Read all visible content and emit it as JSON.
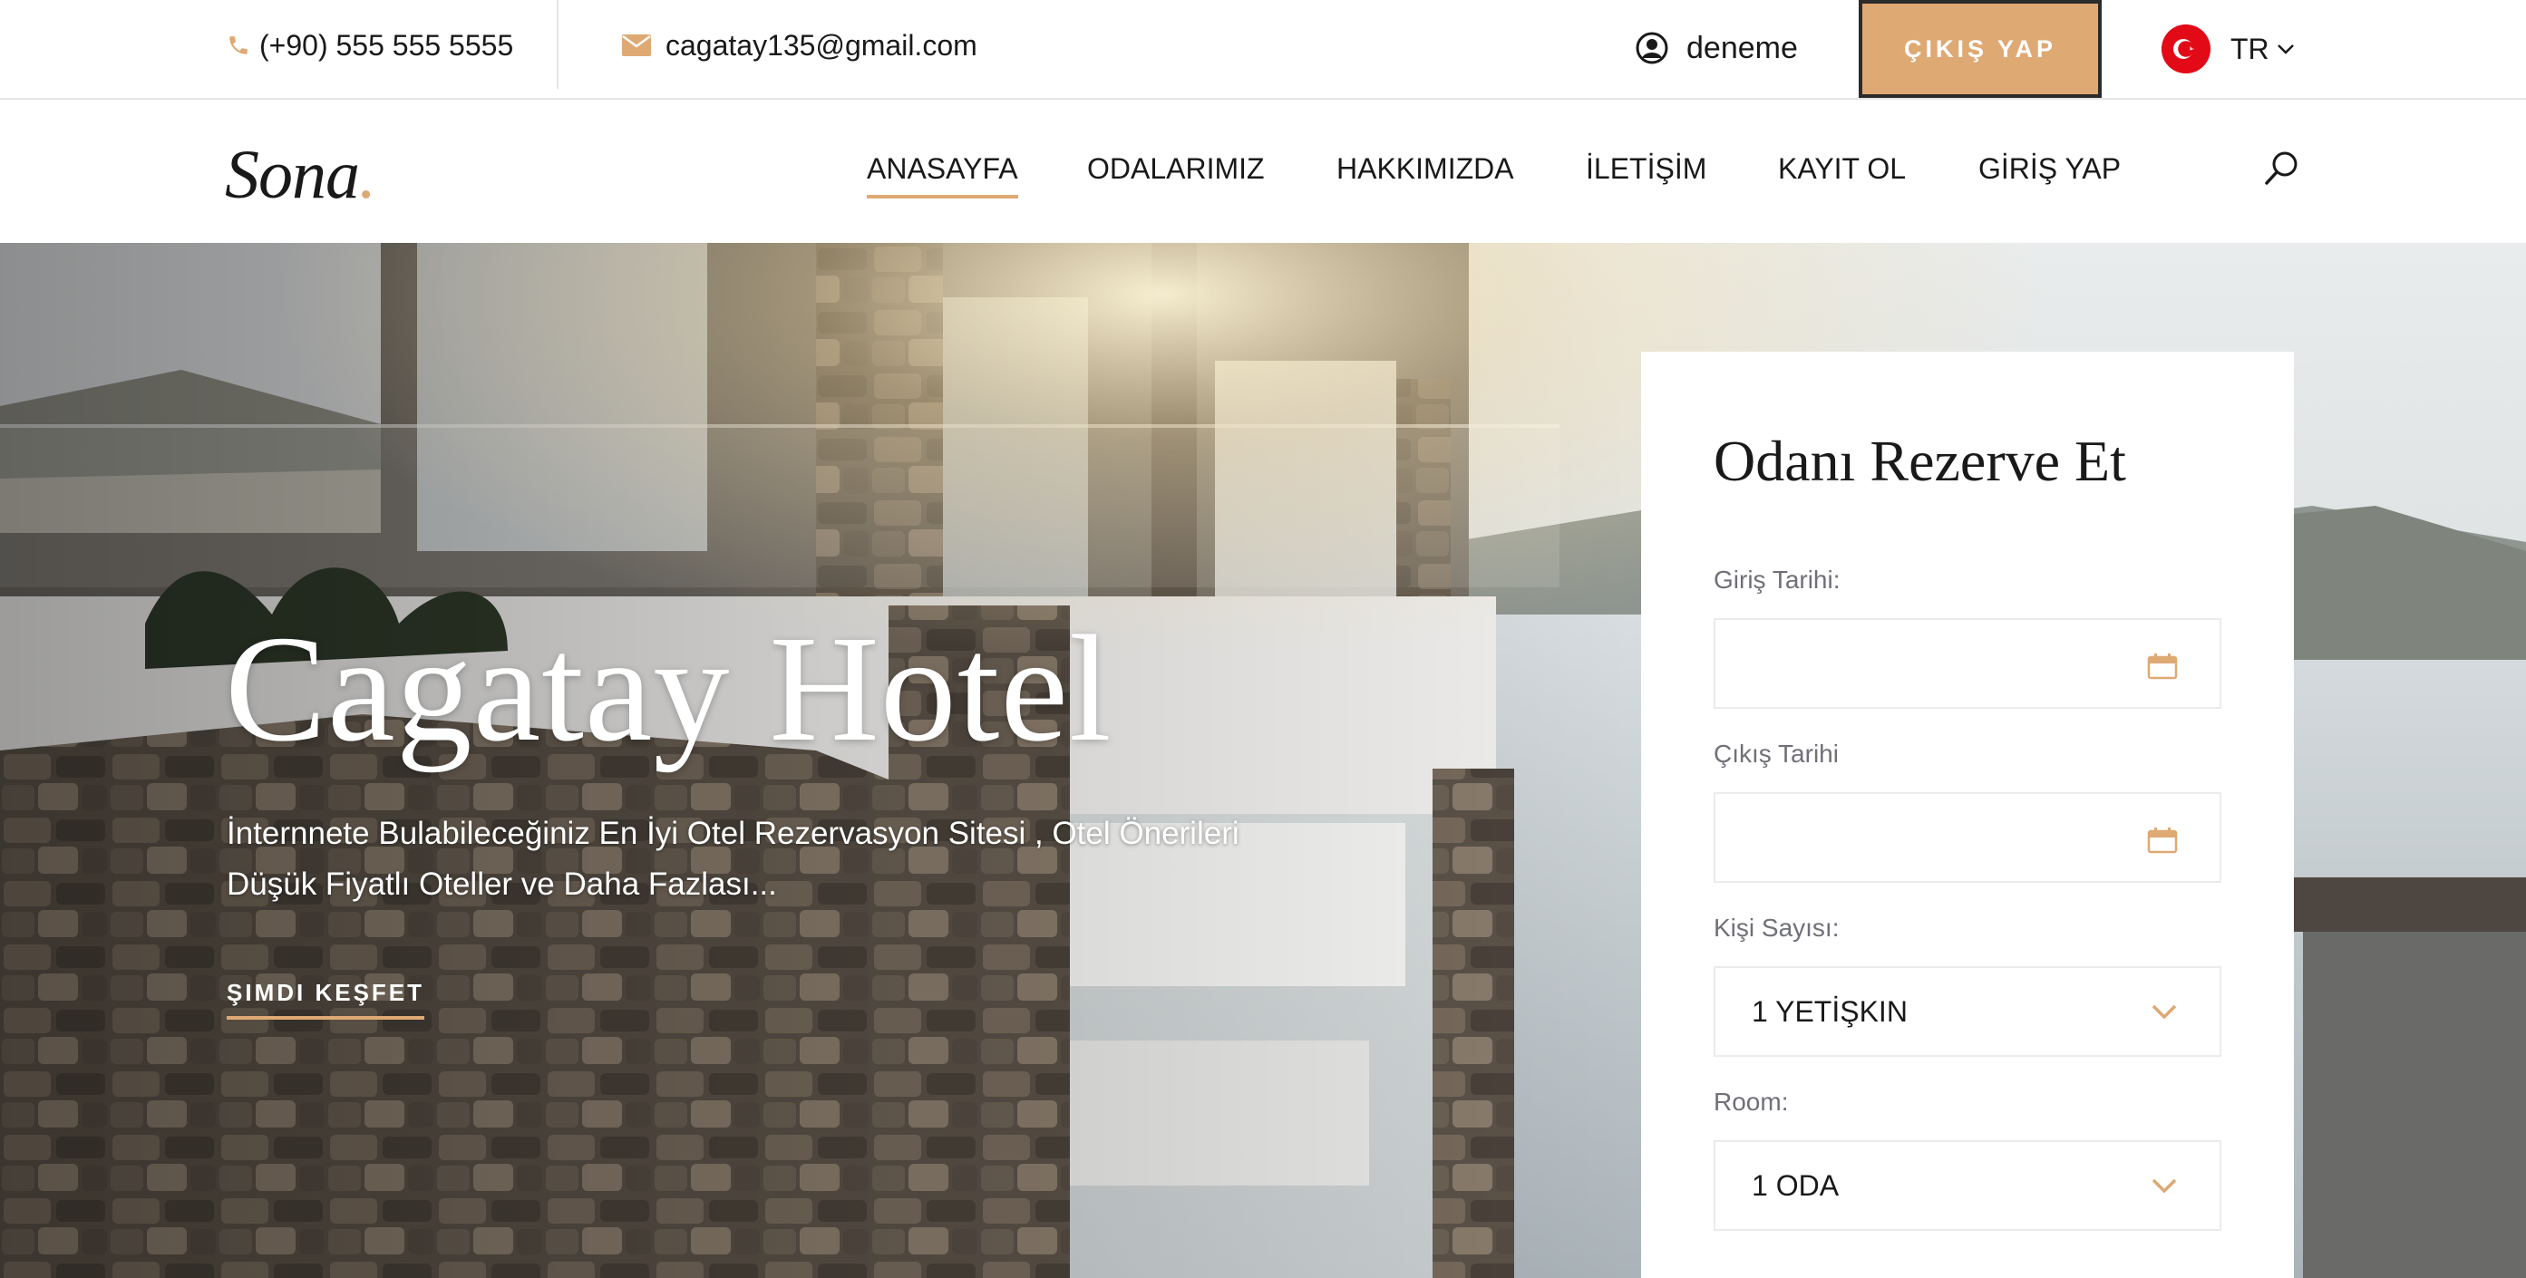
{
  "topbar": {
    "phone": "(+90) 555 555 5555",
    "email": "cagatay135@gmail.com",
    "username": "deneme",
    "logout_label": "ÇIKIŞ YAP",
    "language": "TR"
  },
  "nav": {
    "logo_text": "Sona",
    "logo_dot": ".",
    "items": [
      {
        "label": "ANASAYFA",
        "active": true
      },
      {
        "label": "ODALARIMIZ",
        "active": false
      },
      {
        "label": "HAKKIMIZDA",
        "active": false
      },
      {
        "label": "İLETİŞİM",
        "active": false
      },
      {
        "label": "KAYIT OL",
        "active": false
      },
      {
        "label": "GİRİŞ YAP",
        "active": false
      }
    ]
  },
  "hero": {
    "title": "Cagatay Hotel",
    "subtitle": "İnternnete Bulabileceğiniz En İyi Otel Rezervasyon Sitesi , Otel Önerileri Düşük Fiyatlı Oteller ve Daha Fazlası...",
    "cta_label": "ŞIMDI KEŞFET"
  },
  "booking": {
    "title": "Odanı Rezerve Et",
    "checkin_label": "Giriş Tarihi:",
    "checkin_value": "",
    "checkout_label": "Çıkış Tarihi",
    "checkout_value": "",
    "guests_label": "Kişi Sayısı:",
    "guests_value": "1 YETİŞKIN",
    "room_label": "Room:",
    "room_value": "1 ODA"
  },
  "colors": {
    "accent": "#dfa974",
    "text": "#19191a",
    "muted": "#707079"
  }
}
